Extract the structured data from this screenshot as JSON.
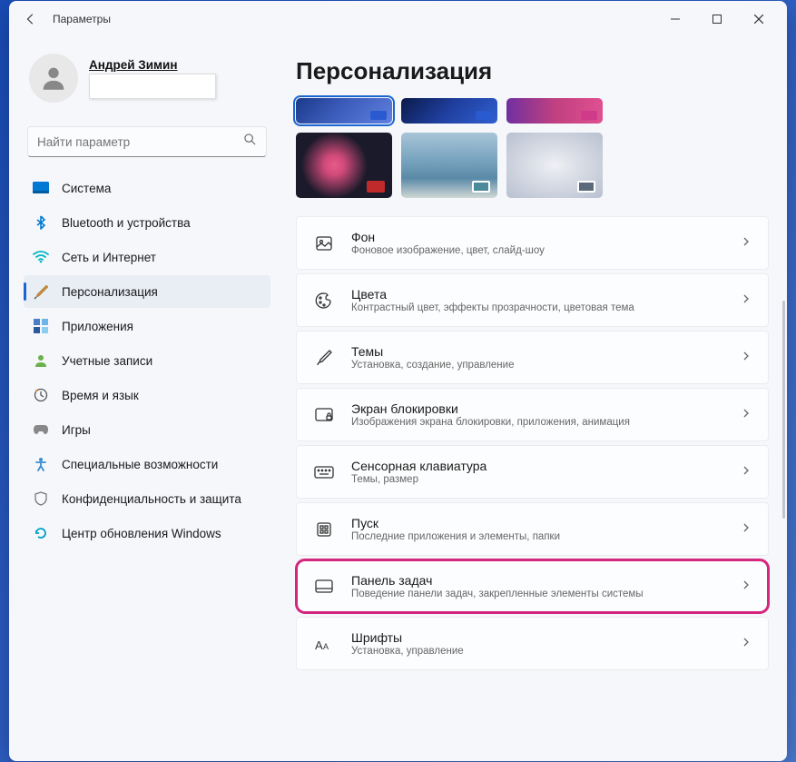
{
  "app_title": "Параметры",
  "profile": {
    "name": "Андрей Зимин"
  },
  "search": {
    "placeholder": "Найти параметр"
  },
  "nav": {
    "items": [
      {
        "label": "Система"
      },
      {
        "label": "Bluetooth и устройства"
      },
      {
        "label": "Сеть и Интернет"
      },
      {
        "label": "Персонализация"
      },
      {
        "label": "Приложения"
      },
      {
        "label": "Учетные записи"
      },
      {
        "label": "Время и язык"
      },
      {
        "label": "Игры"
      },
      {
        "label": "Специальные возможности"
      },
      {
        "label": "Конфиденциальность и защита"
      },
      {
        "label": "Центр обновления Windows"
      }
    ]
  },
  "page_title": "Персонализация",
  "settings": [
    {
      "title": "Фон",
      "desc": "Фоновое изображение, цвет, слайд-шоу"
    },
    {
      "title": "Цвета",
      "desc": "Контрастный цвет, эффекты прозрачности, цветовая тема"
    },
    {
      "title": "Темы",
      "desc": "Установка, создание, управление"
    },
    {
      "title": "Экран блокировки",
      "desc": "Изображения экрана блокировки, приложения, анимация"
    },
    {
      "title": "Сенсорная клавиатура",
      "desc": "Темы, размер"
    },
    {
      "title": "Пуск",
      "desc": "Последние приложения и элементы, папки"
    },
    {
      "title": "Панель задач",
      "desc": "Поведение панели задач, закрепленные элементы системы"
    },
    {
      "title": "Шрифты",
      "desc": "Установка, управление"
    }
  ]
}
